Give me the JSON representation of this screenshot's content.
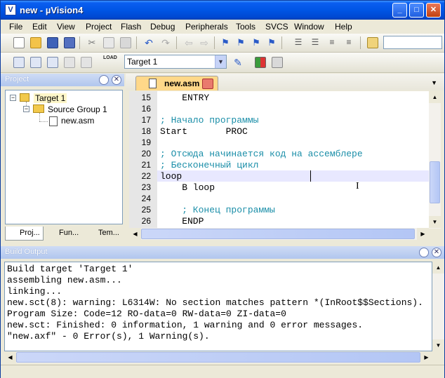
{
  "window": {
    "title": "new - µVision4",
    "minimize": "_",
    "maximize": "□",
    "close": "✕"
  },
  "menu": [
    "File",
    "Edit",
    "View",
    "Project",
    "Flash",
    "Debug",
    "Peripherals",
    "Tools",
    "SVCS",
    "Window",
    "Help"
  ],
  "toolbar": {
    "target_select": "Target 1",
    "load_label": "LOAD"
  },
  "project_panel": {
    "title": "Project",
    "tree": {
      "target": "Target 1",
      "group": "Source Group 1",
      "file": "new.asm"
    },
    "tabs": [
      "Proj...",
      "Fun...",
      "Tem..."
    ]
  },
  "editor": {
    "tab_label": "new.asm",
    "lines": [
      {
        "num": "15",
        "text": "    ENTRY",
        "comment": false
      },
      {
        "num": "16",
        "text": "",
        "comment": false
      },
      {
        "num": "17",
        "text": "; Начало программы",
        "comment": true
      },
      {
        "num": "18",
        "text": "Start       PROC",
        "comment": false
      },
      {
        "num": "19",
        "text": "",
        "comment": false
      },
      {
        "num": "20",
        "text": "; Отсюда начинается код на ассемблере",
        "comment": true
      },
      {
        "num": "21",
        "text": "; Бесконечный цикл",
        "comment": true
      },
      {
        "num": "22",
        "text": "loop",
        "comment": false
      },
      {
        "num": "23",
        "text": "    B loop",
        "comment": false
      },
      {
        "num": "24",
        "text": "",
        "comment": false
      },
      {
        "num": "25",
        "text": "    ; Конец программы",
        "comment": true
      },
      {
        "num": "26",
        "text": "    ENDP",
        "comment": false
      }
    ]
  },
  "build_output": {
    "title": "Build Output",
    "lines": [
      "Build target 'Target 1'",
      "assembling new.asm...",
      "linking...",
      "new.sct(8): warning: L6314W: No section matches pattern *(InRoot$$Sections).",
      "Program Size: Code=12 RO-data=0 RW-data=0 ZI-data=0",
      "new.sct: Finished: 0 information, 1 warning and 0 error messages.",
      "\"new.axf\" - 0 Error(s), 1 Warning(s)."
    ]
  },
  "colors": {
    "title_bar": "#0055e5",
    "comment": "#1a8ea8",
    "current_line": "#e8e8ff",
    "tab_active": "#ffd889"
  }
}
